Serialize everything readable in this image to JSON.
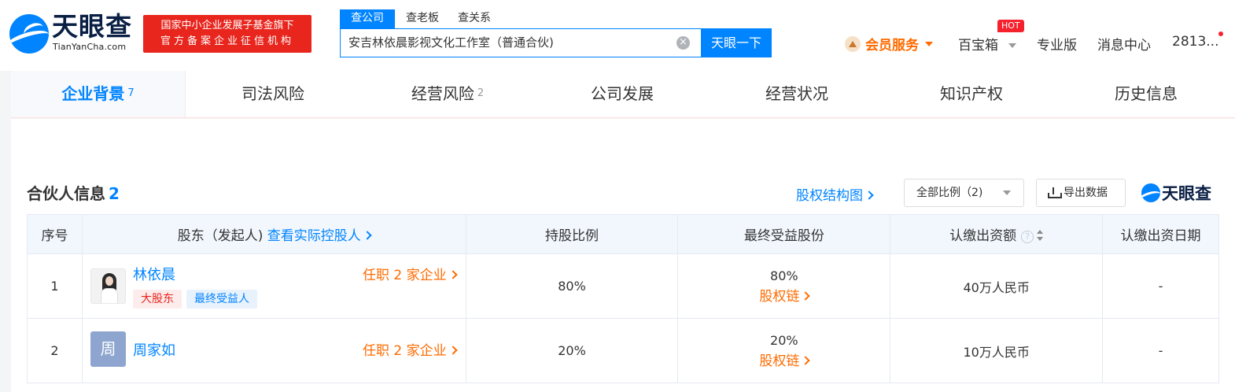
{
  "brand": {
    "name": "天眼查",
    "sub": "TianYanCha.com",
    "badge_line1": "国家中小企业发展子基金旗下",
    "badge_line2": "官方备案企业征信机构"
  },
  "search": {
    "tabs": [
      "查公司",
      "查老板",
      "查关系"
    ],
    "value": "安吉林依晨影视文化工作室（普通合伙)",
    "clear_icon": "×",
    "button_label": "天眼一下"
  },
  "topnav": {
    "member": "会员服务",
    "toolbox": "百宝箱",
    "hot_badge": "HOT",
    "pro": "专业版",
    "messages": "消息中心",
    "user": "2813..."
  },
  "main_tabs": [
    {
      "label": "企业背景",
      "count": "7"
    },
    {
      "label": "司法风险",
      "count": ""
    },
    {
      "label": "经营风险",
      "count": "2"
    },
    {
      "label": "公司发展",
      "count": ""
    },
    {
      "label": "经营状况",
      "count": ""
    },
    {
      "label": "知识产权",
      "count": ""
    },
    {
      "label": "历史信息",
      "count": ""
    }
  ],
  "section": {
    "title": "合伙人信息",
    "count": "2",
    "equity_link": "股权结构图",
    "filter": "全部比例（2)",
    "export": "导出数据",
    "watermark": "天眼查"
  },
  "table": {
    "headers": {
      "index": "序号",
      "shareholder": "股东（发起人)",
      "actual_controller_link": "查看实际控股人",
      "ratio": "持股比例",
      "final_benefit": "最终受益股份",
      "subscribed_amount": "认缴出资额",
      "help_icon": "?",
      "subscribed_date": "认缴出资日期"
    },
    "rows": [
      {
        "index": "1",
        "name": "林依晨",
        "tags": [
          "大股东",
          "最终受益人"
        ],
        "positions": "任职 2 家企业",
        "ratio": "80%",
        "final_benefit": "80%",
        "chain": "股权链",
        "amount": "40万人民币",
        "date": "-"
      },
      {
        "index": "2",
        "name": "周家如",
        "avatar_letter": "周",
        "tags": [],
        "positions": "任职 2 家企业",
        "ratio": "20%",
        "final_benefit": "20%",
        "chain": "股权链",
        "amount": "10万人民币",
        "date": "-"
      }
    ]
  },
  "colors": {
    "primary": "#0084ff",
    "orange": "#ff6b00",
    "red": "#e8261e"
  }
}
